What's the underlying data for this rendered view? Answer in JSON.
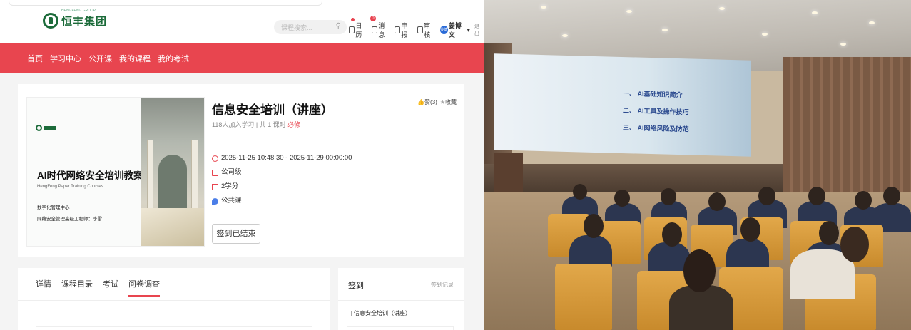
{
  "header": {
    "logo_text": "恒丰集团",
    "logo_subtext": "HENGFENG GROUP",
    "search_placeholder": "课程搜索...",
    "tools": [
      {
        "label": "日历",
        "icon": "calendar-icon"
      },
      {
        "label": "消息",
        "icon": "bell-icon",
        "badge": "0"
      },
      {
        "label": "申报",
        "icon": "document-icon"
      },
      {
        "label": "审核",
        "icon": "review-icon"
      }
    ],
    "avatar_text": "姜博",
    "user_name": "姜博文",
    "logout": "退出"
  },
  "nav": [
    "首页",
    "学习中心",
    "公开课",
    "我的课程",
    "我的考试"
  ],
  "course": {
    "cover": {
      "title": "AI时代网络安全培训教案",
      "subtitle": "HengFeng Paper Training Courses",
      "line1": "数字化管理中心",
      "line2": "网络安全管理高级工程师：李雷"
    },
    "title": "信息安全培训（讲座）",
    "meta": "118人加入学习 | 共 1 课时",
    "required": "必修",
    "likes": "赞(3)",
    "favorite": "收藏",
    "time": "2025-11-25 10:48:30 - 2025-11-29 00:00:00",
    "level": "公司级",
    "credits": "2学分",
    "type": "公共课",
    "sign_button": "签到已结束"
  },
  "tabs": [
    "详情",
    "课程目录",
    "考试",
    "问卷调查"
  ],
  "active_tab": "问卷调查",
  "signin": {
    "heading": "签到",
    "record_link": "签到记录",
    "item": "信息安全培训（讲座）"
  },
  "photo": {
    "screen_lines": [
      "一、   AI基础知识简介",
      "二、   AI工具及操作技巧",
      "三、   AI网络风险及防范"
    ]
  }
}
